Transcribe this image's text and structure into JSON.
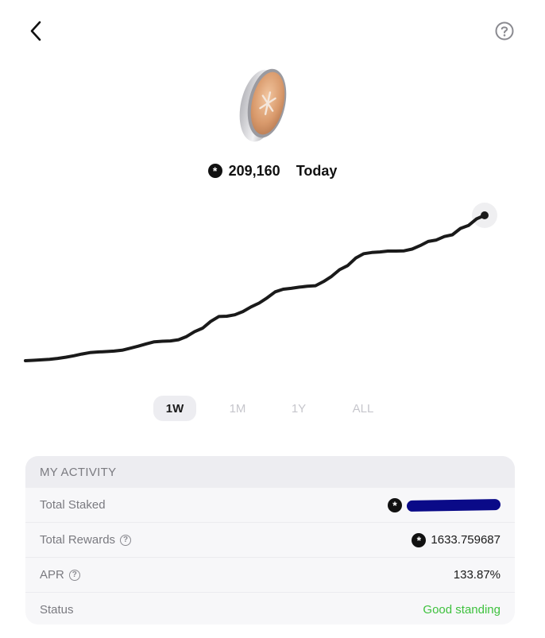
{
  "header": {
    "back_icon": "chevron-left-icon",
    "help_icon": "question-circle-icon"
  },
  "balance": {
    "token_icon": "asterisk-token-icon",
    "value": "209,160",
    "period": "Today"
  },
  "chart_data": {
    "type": "line",
    "x": [
      0,
      1,
      2,
      3,
      4,
      5,
      6,
      7,
      8,
      9,
      10,
      11,
      12,
      13,
      14,
      15,
      16,
      17,
      18,
      19,
      20,
      21,
      22,
      23,
      24,
      25,
      26,
      27,
      28,
      29,
      30,
      31,
      32,
      33,
      34,
      35,
      36,
      37,
      38,
      39,
      40,
      41,
      42,
      43,
      44,
      45,
      46,
      47,
      48,
      49,
      50,
      51,
      52,
      53,
      54,
      55,
      56,
      57
    ],
    "values": [
      0.0,
      0.3,
      0.6,
      1.0,
      1.6,
      2.4,
      3.4,
      4.6,
      5.6,
      6.0,
      6.3,
      6.6,
      7.2,
      8.6,
      10.0,
      11.6,
      13.0,
      13.4,
      13.6,
      14.4,
      16.6,
      20.0,
      22.4,
      27.0,
      30.4,
      30.6,
      31.6,
      33.8,
      37.0,
      39.6,
      43.2,
      47.4,
      49.2,
      49.8,
      50.6,
      51.2,
      51.6,
      54.4,
      58.0,
      62.6,
      65.4,
      70.6,
      73.6,
      74.4,
      74.8,
      75.4,
      75.4,
      75.6,
      76.8,
      79.2,
      82.0,
      83.0,
      85.4,
      86.6,
      91.0,
      93.0,
      97.6,
      100.0
    ],
    "marker": "last-point",
    "grid": false,
    "legend": false
  },
  "ranges": [
    {
      "label": "1W",
      "active": true
    },
    {
      "label": "1M",
      "active": false
    },
    {
      "label": "1Y",
      "active": false
    },
    {
      "label": "ALL",
      "active": false
    }
  ],
  "activity": {
    "title": "MY ACTIVITY",
    "rows": [
      {
        "label": "Total Staked",
        "value": ""
      },
      {
        "label": "Total Rewards",
        "value": "1633.759687"
      },
      {
        "label": "APR",
        "value": "133.87%"
      },
      {
        "label": "Status",
        "value": "Good standing"
      }
    ],
    "status_color": "#3ec13e",
    "redaction_color": "#0a0a88"
  }
}
